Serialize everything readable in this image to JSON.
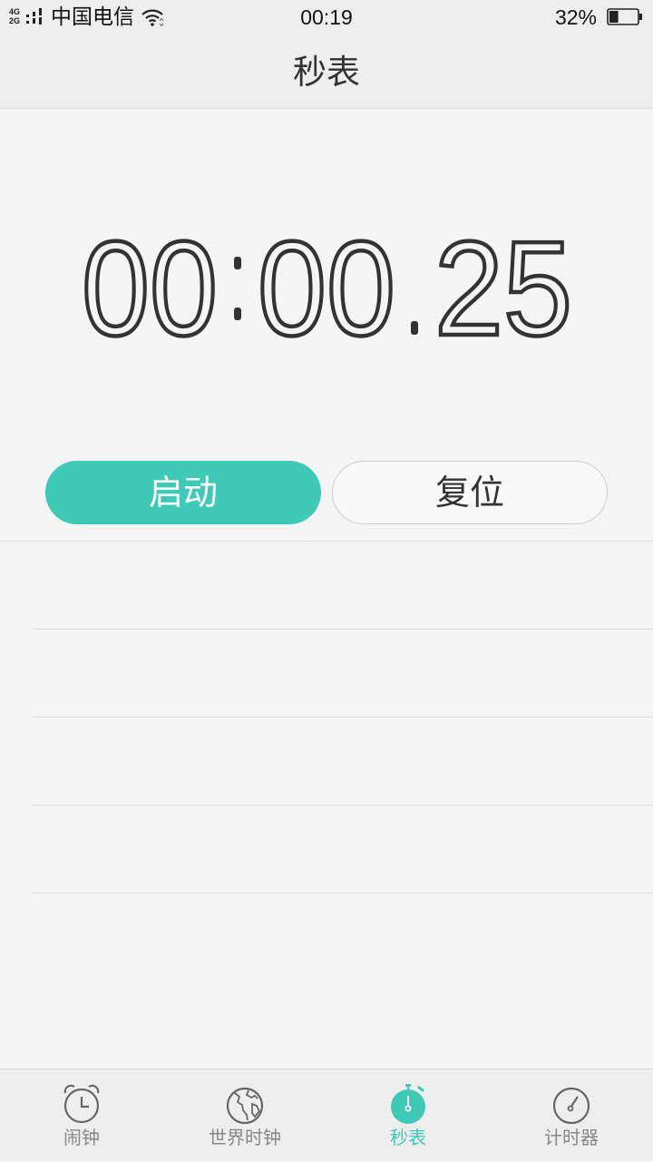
{
  "status_bar": {
    "network_top": "4G",
    "network_bottom": "2G",
    "carrier": "中国电信",
    "time": "00:19",
    "battery_percent": "32%",
    "battery_level": 0.32
  },
  "header": {
    "title": "秒表"
  },
  "stopwatch": {
    "minutes": "00",
    "seconds": "00",
    "centiseconds": "25"
  },
  "controls": {
    "start_label": "启动",
    "reset_label": "复位"
  },
  "lap_list": {
    "rows": [
      "",
      "",
      "",
      ""
    ]
  },
  "bottom_nav": {
    "items": [
      {
        "label": "闹钟",
        "icon": "alarm-clock-icon",
        "active": false
      },
      {
        "label": "世界时钟",
        "icon": "globe-icon",
        "active": false
      },
      {
        "label": "秒表",
        "icon": "stopwatch-icon",
        "active": true
      },
      {
        "label": "计时器",
        "icon": "timer-icon",
        "active": false
      }
    ]
  },
  "colors": {
    "accent": "#3ecab7",
    "background": "#f5f5f5",
    "bar": "#eeeeee",
    "text": "#333333",
    "inactive": "#888888"
  }
}
